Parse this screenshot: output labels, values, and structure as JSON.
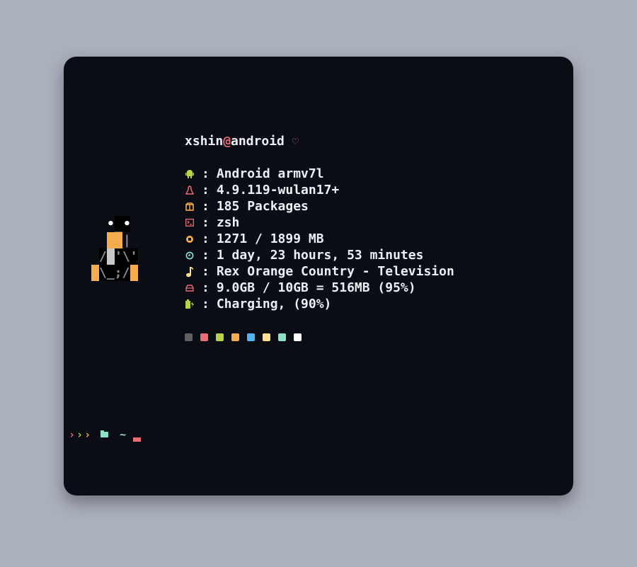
{
  "header": {
    "user": "xshin",
    "at": "@",
    "host": "android",
    "heart": "♡"
  },
  "info": [
    {
      "icon": "android-icon",
      "color": "#b9d24a",
      "value": "Android armv7l"
    },
    {
      "icon": "linux-icon",
      "color": "#ec6b76",
      "value": "4.9.119-wulan17+"
    },
    {
      "icon": "package-icon",
      "color": "#f6ad4f",
      "value": "185 Packages"
    },
    {
      "icon": "terminal-icon",
      "color": "#ec6b76",
      "value": "zsh"
    },
    {
      "icon": "cpu-icon",
      "color": "#f6ad4f",
      "value": "1271 / 1899 MB"
    },
    {
      "icon": "clock-icon",
      "color": "#8de0c6",
      "value": "1 day, 23 hours, 53 minutes"
    },
    {
      "icon": "music-icon",
      "color": "#fbe28e",
      "value": "Rex Orange Country - Television"
    },
    {
      "icon": "disk-icon",
      "color": "#ec6b76",
      "value": "9.0GB / 10GB = 516MB (95%)"
    },
    {
      "icon": "battery-icon",
      "color": "#b9d24a",
      "value": "Charging, (90%)"
    }
  ],
  "separator": ":",
  "palette": [
    "#606060",
    "#ec6b76",
    "#b9d24a",
    "#f6ad4f",
    "#4fb6f0",
    "#fbe28e",
    "#8de0c6",
    "#ffffff"
  ],
  "prompt": {
    "arrows": [
      "›",
      "›",
      "›"
    ],
    "arrow_colors": [
      "#ec6b76",
      "#b9d24a",
      "#f6ad4f"
    ],
    "dir": "~",
    "cursor_color": "#ec6b76"
  }
}
